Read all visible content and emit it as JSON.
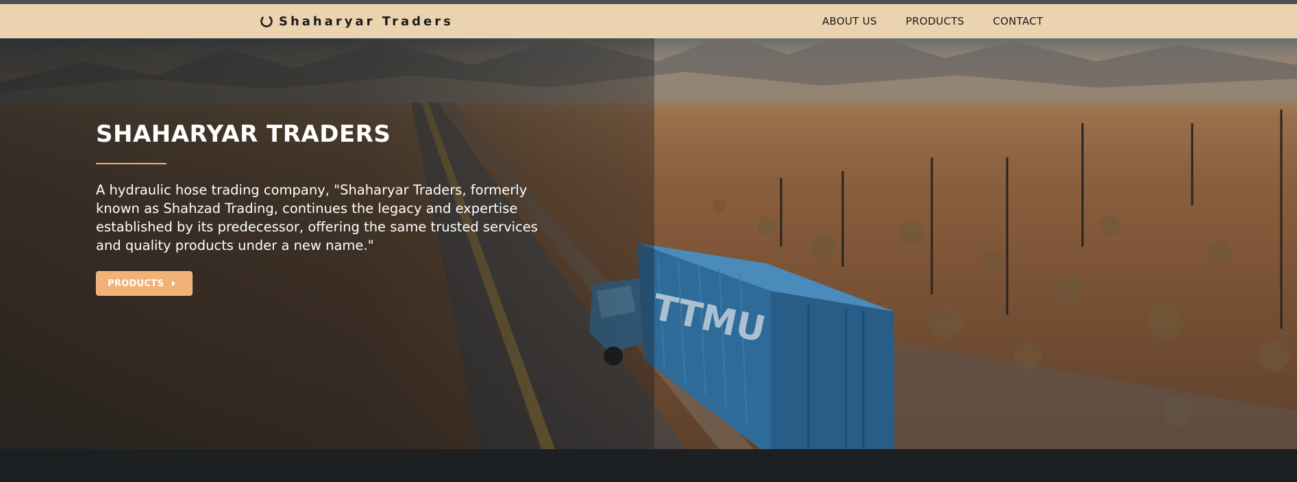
{
  "brand": {
    "name": "Shaharyar Traders",
    "icon": "spinner-ring-icon"
  },
  "nav": {
    "items": [
      {
        "label": "ABOUT US"
      },
      {
        "label": "PRODUCTS"
      },
      {
        "label": "CONTACT"
      }
    ]
  },
  "hero": {
    "title": "SHAHARYAR TRADERS",
    "description": "A hydraulic hose trading company, \"Shaharyar Traders, formerly known as Shahzad Trading, continues the legacy and expertise established by its predecessor, offering the same trusted services and quality products under a new name.\"",
    "button_label": "PRODUCTS",
    "button_icon": "caret-right-icon",
    "container_text": "TTMU"
  },
  "colors": {
    "navbar_bg": "#ecd3af",
    "accent": "#f0b276",
    "footer_bg": "#1d2022"
  }
}
